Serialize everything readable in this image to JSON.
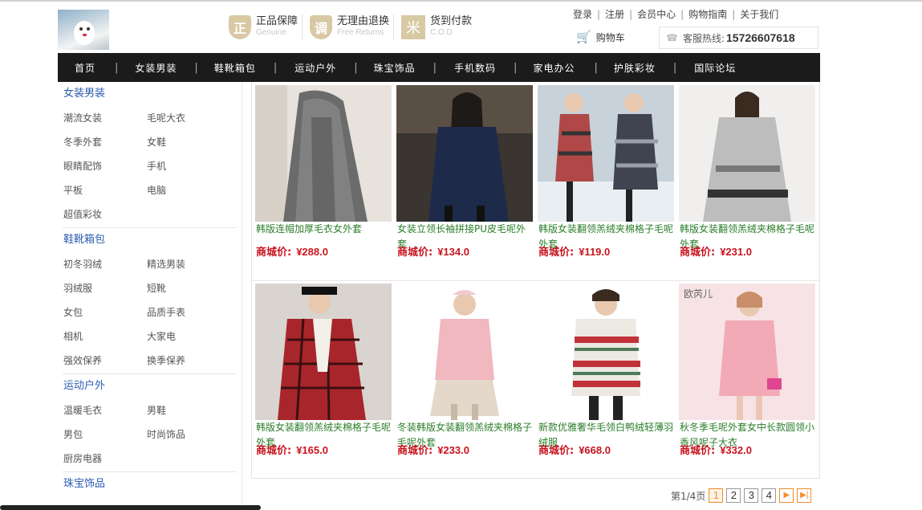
{
  "guarantees": [
    {
      "icon": "genuine-shield-icon",
      "glyph": "正",
      "cn": "正品保障",
      "en": "Genuine"
    },
    {
      "icon": "return-shield-icon",
      "glyph": "调",
      "cn": "无理由退换",
      "en": "Free Returns"
    },
    {
      "icon": "cod-box-icon",
      "glyph": "米",
      "cn": "货到付款",
      "en": "C.O.D"
    }
  ],
  "toplinks": [
    "登录",
    "注册",
    "会员中心",
    "购物指南",
    "关于我们"
  ],
  "cart_label": "购物车",
  "hotline": {
    "label": "客服热线:",
    "number": "15726607618"
  },
  "nav": [
    "首页",
    "女装男装",
    "鞋靴箱包",
    "运动户外",
    "珠宝饰品",
    "手机数码",
    "家电办公",
    "护肤彩妆",
    "国际论坛"
  ],
  "sidebar": [
    {
      "title": "女装男装",
      "items": [
        "潮流女装",
        "毛呢大衣",
        "冬季外套",
        "女鞋",
        "眼睛配饰",
        "手机",
        "平板",
        "电脑",
        "超值彩妆"
      ]
    },
    {
      "title": "鞋靴箱包",
      "items": [
        "初冬羽绒",
        "精选男装",
        "羽绒服",
        "短靴",
        "女包",
        "品质手表",
        "相机",
        "大家电",
        "强效保养",
        "换季保养"
      ]
    },
    {
      "title": "运动户外",
      "items": [
        "温暖毛衣",
        "男鞋",
        "男包",
        "时尚饰品",
        "厨房电器"
      ]
    },
    {
      "title": "珠宝饰品",
      "items": []
    }
  ],
  "price_label": "商城价:",
  "products": [
    {
      "name": "韩版连帽加厚毛衣女外套",
      "price": "¥288.0"
    },
    {
      "name": "女装立领长袖拼接PU皮毛呢外套",
      "price": "¥134.0"
    },
    {
      "name": "韩版女装翻领羔绒夹棉格子毛呢外套",
      "price": "¥119.0"
    },
    {
      "name": "韩版女装翻领羔绒夹棉格子毛呢外套",
      "price": "¥231.0"
    },
    {
      "name": "韩版女装翻领羔绒夹棉格子毛呢外套",
      "price": "¥165.0"
    },
    {
      "name": "冬装韩版女装翻领羔绒夹棉格子毛呢外套",
      "price": "¥233.0"
    },
    {
      "name": "新款优雅奢华毛领白鸭绒轻薄羽绒服",
      "price": "¥668.0"
    },
    {
      "name": "秋冬季毛呢外套女中长款圆领小香风呢子大衣",
      "price": "¥332.0"
    }
  ],
  "product_image_text": "欧芮儿",
  "pager": {
    "info": "第1/4页",
    "pages": [
      "1",
      "2",
      "3",
      "4"
    ],
    "current": "1",
    "next": "▶",
    "last": "▶|"
  }
}
